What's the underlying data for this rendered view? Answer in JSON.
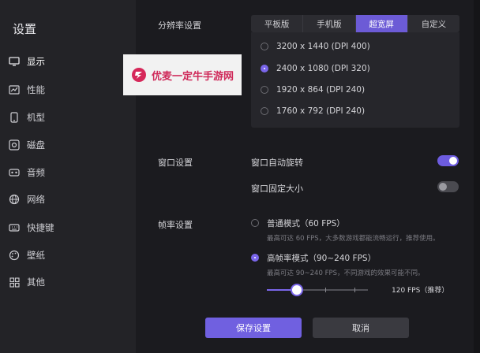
{
  "sidebar": {
    "title": "设置",
    "items": [
      {
        "label": "显示",
        "icon": "monitor-icon",
        "active": true
      },
      {
        "label": "性能",
        "icon": "chart-icon",
        "active": false
      },
      {
        "label": "机型",
        "icon": "phone-icon",
        "active": false
      },
      {
        "label": "磁盘",
        "icon": "disk-icon",
        "active": false
      },
      {
        "label": "音频",
        "icon": "speaker-icon",
        "active": false
      },
      {
        "label": "网络",
        "icon": "globe-icon",
        "active": false
      },
      {
        "label": "快捷键",
        "icon": "keyboard-icon",
        "active": false
      },
      {
        "label": "壁纸",
        "icon": "palette-icon",
        "active": false
      },
      {
        "label": "其他",
        "icon": "grid-icon",
        "active": false
      }
    ]
  },
  "resolution": {
    "label": "分辨率设置",
    "tabs": [
      {
        "label": "平板版",
        "active": false
      },
      {
        "label": "手机版",
        "active": false
      },
      {
        "label": "超宽屏",
        "active": true
      },
      {
        "label": "自定义",
        "active": false
      }
    ],
    "options": [
      {
        "label": "3200 x 1440 (DPI 400)",
        "selected": false
      },
      {
        "label": "2400 x 1080 (DPI 320)",
        "selected": true
      },
      {
        "label": "1920 x 864 (DPI 240)",
        "selected": false
      },
      {
        "label": "1760 x 792 (DPI 240)",
        "selected": false
      }
    ]
  },
  "window": {
    "label": "窗口设置",
    "auto_rotate": {
      "label": "窗口自动旋转",
      "on": true
    },
    "fixed_size": {
      "label": "窗口固定大小",
      "on": false
    }
  },
  "framerate": {
    "label": "帧率设置",
    "normal": {
      "label": "普通模式（60 FPS）",
      "hint": "最高可达 60 FPS，大多数游戏都能流畅运行，推荐使用。",
      "selected": false
    },
    "high": {
      "label": "高帧率模式（90~240 FPS）",
      "hint": "最高可达 90~240 FPS，不同游戏的效果可能不同。",
      "selected": true
    },
    "slider_value": "120 FPS（推荐）",
    "slider_fraction": 0.3
  },
  "buttons": {
    "save": "保存设置",
    "cancel": "取消"
  },
  "watermark": {
    "text": "优麦一定牛手游网"
  },
  "colors": {
    "accent": "#7060e0",
    "watermark_text": "#cf2a5a"
  }
}
